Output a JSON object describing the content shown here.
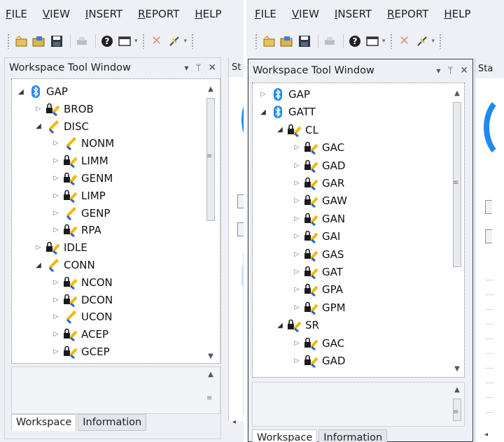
{
  "left": {
    "menu": [
      {
        "label": "FILE",
        "key": "F",
        "rest": "ILE"
      },
      {
        "label": "VIEW",
        "key": "V",
        "rest": "IEW"
      },
      {
        "label": "INSERT",
        "key": "I",
        "rest": "NSERT"
      },
      {
        "label": "REPORT",
        "key": "R",
        "rest": "EPORT"
      },
      {
        "label": "HELP",
        "key": "H",
        "rest": "ELP"
      }
    ],
    "tool_window": {
      "title": "Workspace Tool Window",
      "btn_menu": "▾",
      "btn_pin": "ⵔ",
      "btn_close": "✕"
    },
    "tree": [
      {
        "label": "GAP",
        "expander": "open",
        "icon": "bluetooth-icon",
        "depth": 0
      },
      {
        "label": "BROB",
        "expander": "closed",
        "icon": "lock-key-icon",
        "depth": 1
      },
      {
        "label": "DISC",
        "expander": "open",
        "icon": "key-icon",
        "depth": 1
      },
      {
        "label": "NONM",
        "expander": "closed",
        "icon": "key-icon",
        "depth": 2
      },
      {
        "label": "LIMM",
        "expander": "closed",
        "icon": "lock-key-icon",
        "depth": 2
      },
      {
        "label": "GENM",
        "expander": "closed",
        "icon": "lock-key-icon",
        "depth": 2
      },
      {
        "label": "LIMP",
        "expander": "closed",
        "icon": "lock-key-icon",
        "depth": 2
      },
      {
        "label": "GENP",
        "expander": "closed",
        "icon": "key-icon",
        "depth": 2
      },
      {
        "label": "RPA",
        "expander": "closed",
        "icon": "lock-key-icon",
        "depth": 2
      },
      {
        "label": "IDLE",
        "expander": "closed",
        "icon": "lock-key-icon",
        "depth": 1
      },
      {
        "label": "CONN",
        "expander": "open",
        "icon": "key-icon",
        "depth": 1
      },
      {
        "label": "NCON",
        "expander": "closed",
        "icon": "lock-key-icon",
        "depth": 2
      },
      {
        "label": "DCON",
        "expander": "closed",
        "icon": "lock-key-icon",
        "depth": 2
      },
      {
        "label": "UCON",
        "expander": "closed",
        "icon": "key-icon",
        "depth": 2
      },
      {
        "label": "ACEP",
        "expander": "closed",
        "icon": "lock-key-icon",
        "depth": 2
      },
      {
        "label": "GCEP",
        "expander": "closed",
        "icon": "lock-key-icon",
        "depth": 2
      }
    ],
    "tabs": [
      "Workspace",
      "Information"
    ],
    "doc_tab": "St"
  },
  "right": {
    "menu": [
      {
        "label": "FILE",
        "key": "F",
        "rest": "ILE"
      },
      {
        "label": "VIEW",
        "key": "V",
        "rest": "IEW"
      },
      {
        "label": "INSERT",
        "key": "I",
        "rest": "NSERT"
      },
      {
        "label": "REPORT",
        "key": "R",
        "rest": "EPORT"
      },
      {
        "label": "HELP",
        "key": "H",
        "rest": "ELP"
      }
    ],
    "tool_window": {
      "title": "Workspace Tool Window",
      "btn_menu": "▾",
      "btn_pin": "ⵔ",
      "btn_close": "✕"
    },
    "tree": [
      {
        "label": "GAP",
        "expander": "closed",
        "icon": "bluetooth-icon",
        "depth": 0
      },
      {
        "label": "GATT",
        "expander": "open",
        "icon": "bluetooth-icon",
        "depth": 0
      },
      {
        "label": "CL",
        "expander": "open",
        "icon": "lock-key-icon",
        "depth": 1
      },
      {
        "label": "GAC",
        "expander": "closed",
        "icon": "lock-key-icon",
        "depth": 2
      },
      {
        "label": "GAD",
        "expander": "closed",
        "icon": "lock-key-icon",
        "depth": 2
      },
      {
        "label": "GAR",
        "expander": "closed",
        "icon": "lock-key-icon",
        "depth": 2
      },
      {
        "label": "GAW",
        "expander": "closed",
        "icon": "lock-key-icon",
        "depth": 2
      },
      {
        "label": "GAN",
        "expander": "closed",
        "icon": "lock-key-icon",
        "depth": 2
      },
      {
        "label": "GAI",
        "expander": "closed",
        "icon": "lock-key-icon",
        "depth": 2
      },
      {
        "label": "GAS",
        "expander": "closed",
        "icon": "lock-key-icon",
        "depth": 2
      },
      {
        "label": "GAT",
        "expander": "closed",
        "icon": "lock-key-icon",
        "depth": 2
      },
      {
        "label": "GPA",
        "expander": "closed",
        "icon": "lock-key-icon",
        "depth": 2
      },
      {
        "label": "GPM",
        "expander": "closed",
        "icon": "lock-key-icon",
        "depth": 2
      },
      {
        "label": "SR",
        "expander": "open",
        "icon": "lock-key-icon",
        "depth": 1
      },
      {
        "label": "GAC",
        "expander": "closed",
        "icon": "lock-key-icon",
        "depth": 2
      },
      {
        "label": "GAD",
        "expander": "closed",
        "icon": "lock-key-icon",
        "depth": 2
      }
    ],
    "tabs": [
      "Workspace",
      "Information"
    ],
    "doc_tab": "Sta"
  },
  "colors": {
    "accent": "#1e8af0",
    "key_yellow": "#f2b705",
    "key_blue": "#2b5cc8",
    "link": "#1a57c8"
  }
}
